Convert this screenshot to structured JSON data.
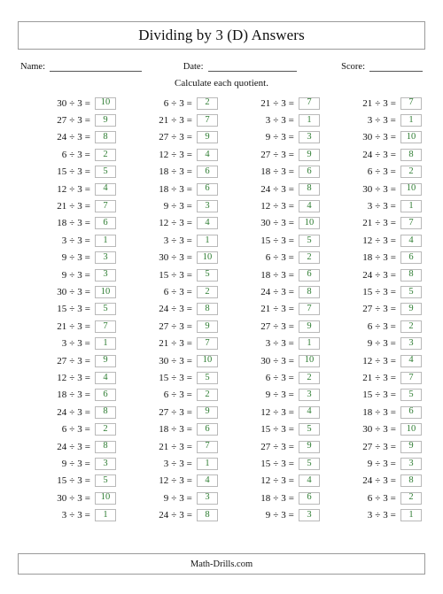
{
  "worksheet": {
    "title": "Dividing by 3 (D) Answers",
    "instruction": "Calculate each quotient.",
    "footer": "Math-Drills.com",
    "divisor": 3,
    "answer_color": "#2e7d32",
    "box_border_color": "#b9b9b9",
    "fields": [
      {
        "label": "Name:",
        "value": ""
      },
      {
        "label": "Date:",
        "value": ""
      },
      {
        "label": "Score:",
        "value": ""
      }
    ],
    "columns": [
      {
        "index": 1,
        "problems": [
          {
            "dividend": 30,
            "divisor": 3,
            "answer": 10
          },
          {
            "dividend": 27,
            "divisor": 3,
            "answer": 9
          },
          {
            "dividend": 24,
            "divisor": 3,
            "answer": 8
          },
          {
            "dividend": 6,
            "divisor": 3,
            "answer": 2
          },
          {
            "dividend": 15,
            "divisor": 3,
            "answer": 5
          },
          {
            "dividend": 12,
            "divisor": 3,
            "answer": 4
          },
          {
            "dividend": 21,
            "divisor": 3,
            "answer": 7
          },
          {
            "dividend": 18,
            "divisor": 3,
            "answer": 6
          },
          {
            "dividend": 3,
            "divisor": 3,
            "answer": 1
          },
          {
            "dividend": 9,
            "divisor": 3,
            "answer": 3
          },
          {
            "dividend": 9,
            "divisor": 3,
            "answer": 3
          },
          {
            "dividend": 30,
            "divisor": 3,
            "answer": 10
          },
          {
            "dividend": 15,
            "divisor": 3,
            "answer": 5
          },
          {
            "dividend": 21,
            "divisor": 3,
            "answer": 7
          },
          {
            "dividend": 3,
            "divisor": 3,
            "answer": 1
          },
          {
            "dividend": 27,
            "divisor": 3,
            "answer": 9
          },
          {
            "dividend": 12,
            "divisor": 3,
            "answer": 4
          },
          {
            "dividend": 18,
            "divisor": 3,
            "answer": 6
          },
          {
            "dividend": 24,
            "divisor": 3,
            "answer": 8
          },
          {
            "dividend": 6,
            "divisor": 3,
            "answer": 2
          },
          {
            "dividend": 24,
            "divisor": 3,
            "answer": 8
          },
          {
            "dividend": 9,
            "divisor": 3,
            "answer": 3
          },
          {
            "dividend": 15,
            "divisor": 3,
            "answer": 5
          },
          {
            "dividend": 30,
            "divisor": 3,
            "answer": 10
          },
          {
            "dividend": 3,
            "divisor": 3,
            "answer": 1
          }
        ]
      },
      {
        "index": 2,
        "problems": [
          {
            "dividend": 6,
            "divisor": 3,
            "answer": 2
          },
          {
            "dividend": 21,
            "divisor": 3,
            "answer": 7
          },
          {
            "dividend": 27,
            "divisor": 3,
            "answer": 9
          },
          {
            "dividend": 12,
            "divisor": 3,
            "answer": 4
          },
          {
            "dividend": 18,
            "divisor": 3,
            "answer": 6
          },
          {
            "dividend": 18,
            "divisor": 3,
            "answer": 6
          },
          {
            "dividend": 9,
            "divisor": 3,
            "answer": 3
          },
          {
            "dividend": 12,
            "divisor": 3,
            "answer": 4
          },
          {
            "dividend": 3,
            "divisor": 3,
            "answer": 1
          },
          {
            "dividend": 30,
            "divisor": 3,
            "answer": 10
          },
          {
            "dividend": 15,
            "divisor": 3,
            "answer": 5
          },
          {
            "dividend": 6,
            "divisor": 3,
            "answer": 2
          },
          {
            "dividend": 24,
            "divisor": 3,
            "answer": 8
          },
          {
            "dividend": 27,
            "divisor": 3,
            "answer": 9
          },
          {
            "dividend": 21,
            "divisor": 3,
            "answer": 7
          },
          {
            "dividend": 30,
            "divisor": 3,
            "answer": 10
          },
          {
            "dividend": 15,
            "divisor": 3,
            "answer": 5
          },
          {
            "dividend": 6,
            "divisor": 3,
            "answer": 2
          },
          {
            "dividend": 27,
            "divisor": 3,
            "answer": 9
          },
          {
            "dividend": 18,
            "divisor": 3,
            "answer": 6
          },
          {
            "dividend": 21,
            "divisor": 3,
            "answer": 7
          },
          {
            "dividend": 3,
            "divisor": 3,
            "answer": 1
          },
          {
            "dividend": 12,
            "divisor": 3,
            "answer": 4
          },
          {
            "dividend": 9,
            "divisor": 3,
            "answer": 3
          },
          {
            "dividend": 24,
            "divisor": 3,
            "answer": 8
          }
        ]
      },
      {
        "index": 3,
        "problems": [
          {
            "dividend": 21,
            "divisor": 3,
            "answer": 7
          },
          {
            "dividend": 3,
            "divisor": 3,
            "answer": 1
          },
          {
            "dividend": 9,
            "divisor": 3,
            "answer": 3
          },
          {
            "dividend": 27,
            "divisor": 3,
            "answer": 9
          },
          {
            "dividend": 18,
            "divisor": 3,
            "answer": 6
          },
          {
            "dividend": 24,
            "divisor": 3,
            "answer": 8
          },
          {
            "dividend": 12,
            "divisor": 3,
            "answer": 4
          },
          {
            "dividend": 30,
            "divisor": 3,
            "answer": 10
          },
          {
            "dividend": 15,
            "divisor": 3,
            "answer": 5
          },
          {
            "dividend": 6,
            "divisor": 3,
            "answer": 2
          },
          {
            "dividend": 18,
            "divisor": 3,
            "answer": 6
          },
          {
            "dividend": 24,
            "divisor": 3,
            "answer": 8
          },
          {
            "dividend": 21,
            "divisor": 3,
            "answer": 7
          },
          {
            "dividend": 27,
            "divisor": 3,
            "answer": 9
          },
          {
            "dividend": 3,
            "divisor": 3,
            "answer": 1
          },
          {
            "dividend": 30,
            "divisor": 3,
            "answer": 10
          },
          {
            "dividend": 6,
            "divisor": 3,
            "answer": 2
          },
          {
            "dividend": 9,
            "divisor": 3,
            "answer": 3
          },
          {
            "dividend": 12,
            "divisor": 3,
            "answer": 4
          },
          {
            "dividend": 15,
            "divisor": 3,
            "answer": 5
          },
          {
            "dividend": 27,
            "divisor": 3,
            "answer": 9
          },
          {
            "dividend": 15,
            "divisor": 3,
            "answer": 5
          },
          {
            "dividend": 12,
            "divisor": 3,
            "answer": 4
          },
          {
            "dividend": 18,
            "divisor": 3,
            "answer": 6
          },
          {
            "dividend": 9,
            "divisor": 3,
            "answer": 3
          }
        ]
      },
      {
        "index": 4,
        "problems": [
          {
            "dividend": 21,
            "divisor": 3,
            "answer": 7
          },
          {
            "dividend": 3,
            "divisor": 3,
            "answer": 1
          },
          {
            "dividend": 30,
            "divisor": 3,
            "answer": 10
          },
          {
            "dividend": 24,
            "divisor": 3,
            "answer": 8
          },
          {
            "dividend": 6,
            "divisor": 3,
            "answer": 2
          },
          {
            "dividend": 30,
            "divisor": 3,
            "answer": 10
          },
          {
            "dividend": 3,
            "divisor": 3,
            "answer": 1
          },
          {
            "dividend": 21,
            "divisor": 3,
            "answer": 7
          },
          {
            "dividend": 12,
            "divisor": 3,
            "answer": 4
          },
          {
            "dividend": 18,
            "divisor": 3,
            "answer": 6
          },
          {
            "dividend": 24,
            "divisor": 3,
            "answer": 8
          },
          {
            "dividend": 15,
            "divisor": 3,
            "answer": 5
          },
          {
            "dividend": 27,
            "divisor": 3,
            "answer": 9
          },
          {
            "dividend": 6,
            "divisor": 3,
            "answer": 2
          },
          {
            "dividend": 9,
            "divisor": 3,
            "answer": 3
          },
          {
            "dividend": 12,
            "divisor": 3,
            "answer": 4
          },
          {
            "dividend": 21,
            "divisor": 3,
            "answer": 7
          },
          {
            "dividend": 15,
            "divisor": 3,
            "answer": 5
          },
          {
            "dividend": 18,
            "divisor": 3,
            "answer": 6
          },
          {
            "dividend": 30,
            "divisor": 3,
            "answer": 10
          },
          {
            "dividend": 27,
            "divisor": 3,
            "answer": 9
          },
          {
            "dividend": 9,
            "divisor": 3,
            "answer": 3
          },
          {
            "dividend": 24,
            "divisor": 3,
            "answer": 8
          },
          {
            "dividend": 6,
            "divisor": 3,
            "answer": 2
          },
          {
            "dividend": 3,
            "divisor": 3,
            "answer": 1
          }
        ]
      }
    ]
  }
}
